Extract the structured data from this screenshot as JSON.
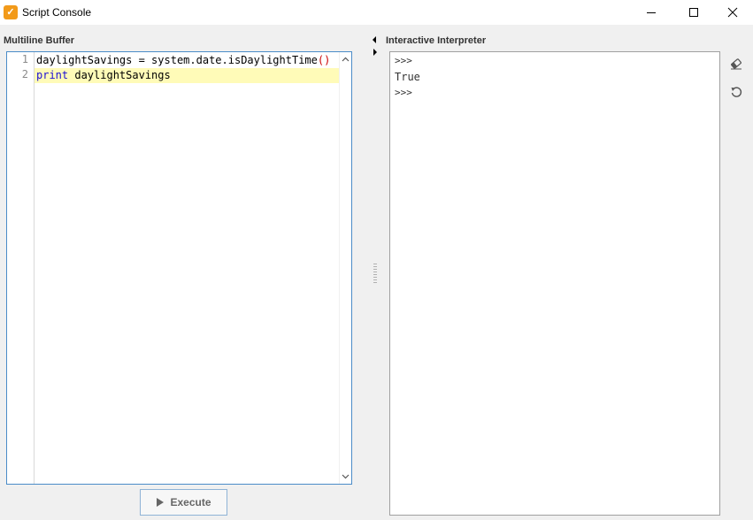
{
  "window": {
    "title": "Script Console",
    "app_icon": "script-console-icon",
    "controls": [
      "minimize-icon",
      "maximize-icon",
      "close-icon"
    ]
  },
  "left_panel": {
    "label": "Multiline Buffer",
    "lines": [
      {
        "number": "1",
        "parts": {
          "a": "daylightSavings = system.date.isDaylightTime",
          "b": "()"
        }
      },
      {
        "number": "2",
        "parts": {
          "a": "print",
          "b": " daylightSavings"
        }
      }
    ],
    "current_line": 2,
    "execute_label": "Execute",
    "execute_icon": "play-icon"
  },
  "right_panel": {
    "label": "Interactive Interpreter",
    "output": [
      ">>>",
      "True",
      ">>>"
    ],
    "tools": [
      "clear-eraser-icon",
      "reset-icon"
    ]
  },
  "colors": {
    "editor_border": "#4b8cc8",
    "current_line_bg": "#fffbb8",
    "keyword": "#1c0fd4",
    "paren": "#cc0000",
    "app_icon": "#f29a1a"
  }
}
